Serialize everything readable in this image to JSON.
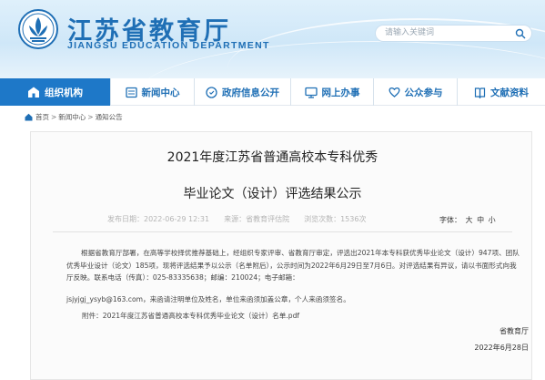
{
  "header": {
    "title": "江苏省教育厅",
    "subtitle": "JIANGSU EDUCATION DEPARTMENT",
    "search_placeholder": "请输入关键词",
    "brand_color": "#1f6fb5"
  },
  "nav": {
    "items": [
      {
        "label": "组织机构",
        "icon": "org-icon",
        "active": true
      },
      {
        "label": "新闻中心",
        "icon": "news-icon",
        "active": false
      },
      {
        "label": "政府信息公开",
        "icon": "info-icon",
        "active": false
      },
      {
        "label": "网上办事",
        "icon": "monitor-icon",
        "active": false
      },
      {
        "label": "公众参与",
        "icon": "heart-icon",
        "active": false
      },
      {
        "label": "文献资料",
        "icon": "books-icon",
        "active": false
      }
    ],
    "active_color": "#1e78c8"
  },
  "breadcrumb": {
    "items": [
      "首页",
      "新闻中心",
      "通知公告"
    ],
    "separator": ">"
  },
  "article": {
    "title_line1": "2021年度江苏省普通高校本专科优秀",
    "title_line2": "毕业论文（设计）评选结果公示",
    "published": "发布日期：2022-06-29 12:31",
    "source": "来源：省教育评估院",
    "views": "浏览次数：1536次",
    "font_size_label": "字体：",
    "font_sizes": [
      "大",
      "中",
      "小"
    ],
    "paragraph1": "根据省教育厅部署，在高等学校择优推荐基础上，经组织专家评审、省教育厅审定，评选出2021年本专科获优秀毕业论文（设计）947项、团队优秀毕业设计（论文）185项，现将评选结果予以公示（名单附后），公示时间为2022年6月29日至7月6日。对评选结果有异议，请以书面形式向我厅反映。联系电话（传真）：025-83335638；邮编：210024；电子邮箱：",
    "paragraph2": "jsjyjgj_ysyb@163.com，来函请注明单位及姓名，单位来函须加盖公章，个人来函须签名。",
    "attachment": "附件：2021年度江苏省普通高校本专科优秀毕业论文（设计）名单.pdf",
    "signature": "省教育厅",
    "date": "2022年6月28日"
  }
}
